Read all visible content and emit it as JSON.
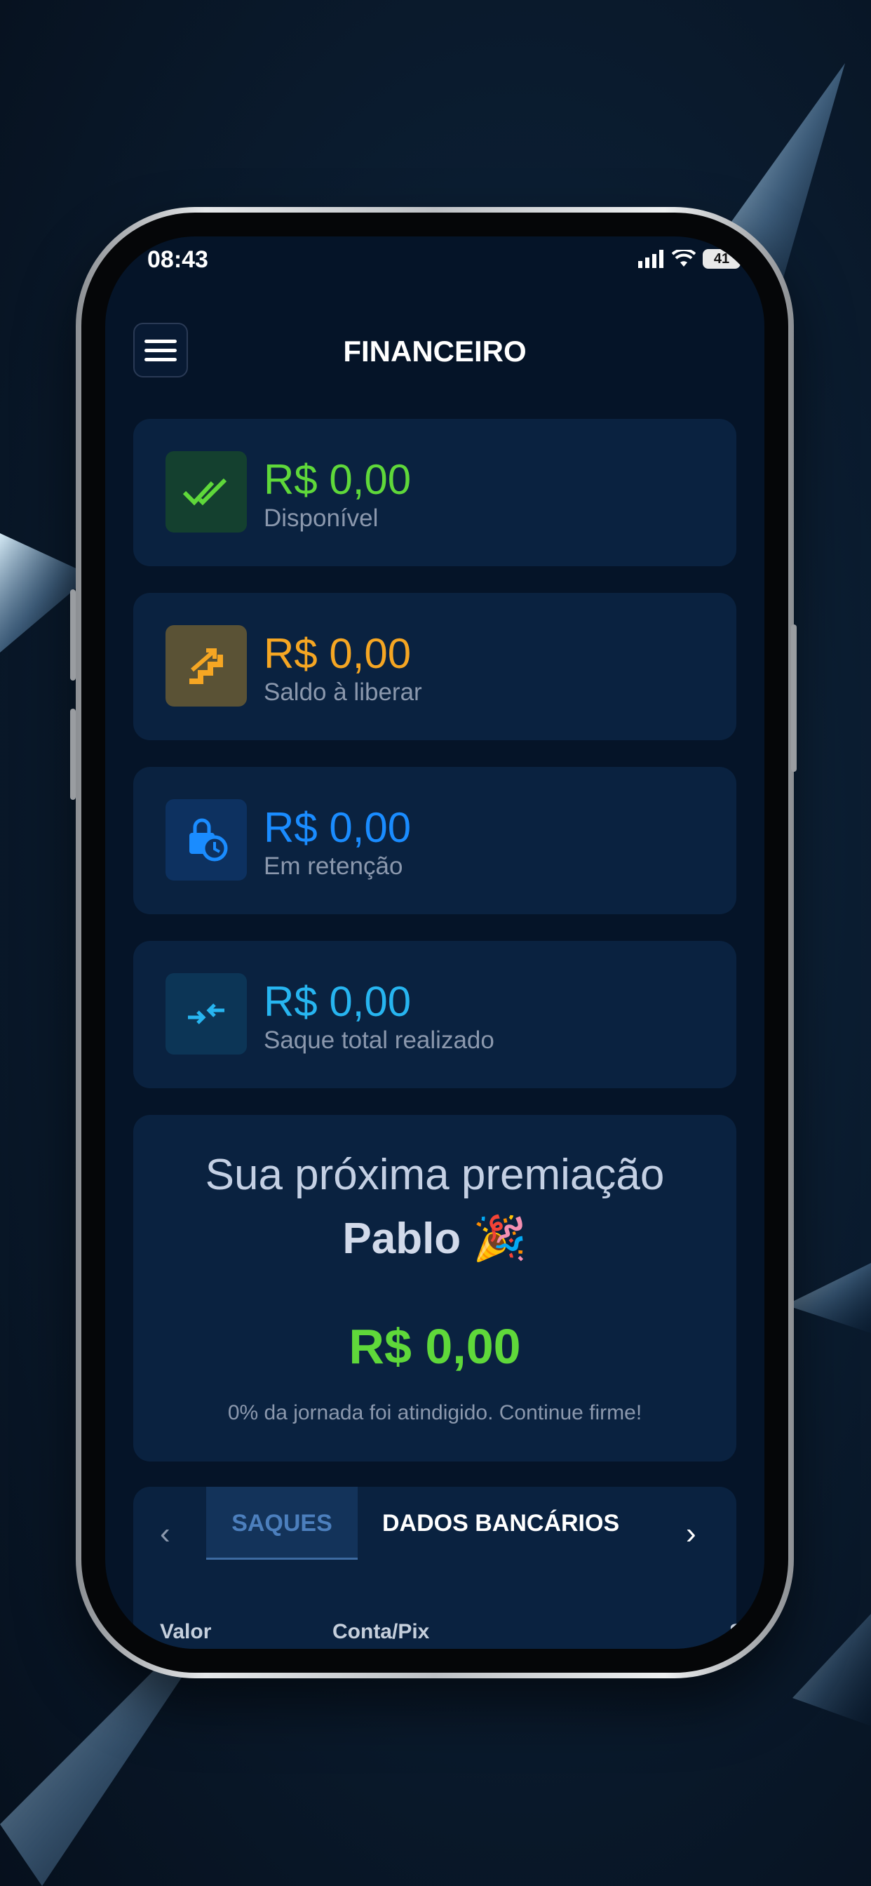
{
  "status_bar": {
    "time": "08:43",
    "battery": "41"
  },
  "header": {
    "title": "FINANCEIRO"
  },
  "balances": [
    {
      "amount": "R$ 0,00",
      "label": "Disponível",
      "color": "#5fd83a",
      "icon": "double-check-icon"
    },
    {
      "amount": "R$ 0,00",
      "label": "Saldo à liberar",
      "color": "#f5a623",
      "icon": "stairs-icon"
    },
    {
      "amount": "R$ 0,00",
      "label": "Em retenção",
      "color": "#1a8cff",
      "icon": "lock-clock-icon"
    },
    {
      "amount": "R$ 0,00",
      "label": "Saque total realizado",
      "color": "#27b5f0",
      "icon": "transfer-arrows-icon"
    }
  ],
  "prize": {
    "heading": "Sua próxima premiação",
    "name": "Pablo",
    "emoji": "🎉",
    "amount": "R$ 0,00",
    "progress_text": "0% da jornada foi atindigido. Continue firme!"
  },
  "tabs": {
    "items": [
      "SAQUES",
      "DADOS BANCÁRIOS"
    ],
    "active": "SAQUES"
  },
  "table": {
    "columns": [
      "Valor",
      "Conta/Pix",
      "Sta"
    ]
  }
}
